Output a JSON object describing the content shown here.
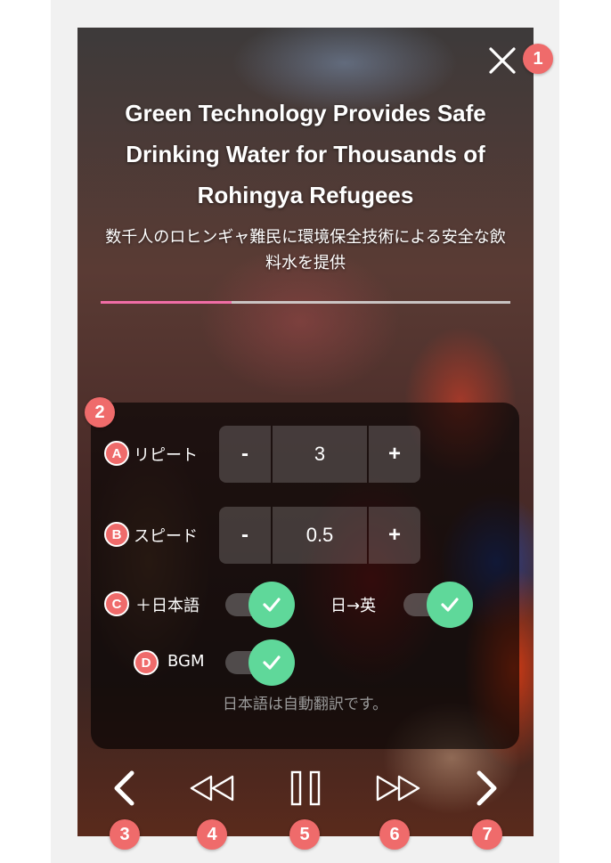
{
  "article": {
    "title_en": "Green Technology Provides Safe Drinking Water for Thousands of Rohingya Refugees",
    "title_ja": "数千人のロヒンギャ難民に環境保全技術による安全な飲料水を提供",
    "progress": 0.32
  },
  "settings": {
    "repeat": {
      "label": "リピート",
      "value": "3",
      "minus": "-",
      "plus": "+"
    },
    "speed": {
      "label": "スピード",
      "value": "0.5",
      "minus": "-",
      "plus": "+"
    },
    "toggles": {
      "japanese": {
        "label": "＋日本語",
        "on": true
      },
      "ja_to_en": {
        "label": "日→英",
        "on": true
      },
      "bgm": {
        "label": "BGM",
        "on": true
      }
    },
    "note": "日本語は自動翻訳です。"
  },
  "badges": {
    "close": "1",
    "panel": "2",
    "prev": "3",
    "rewind": "4",
    "pause": "5",
    "forward": "6",
    "next": "7",
    "repeat": "A",
    "speed": "B",
    "japanese": "C",
    "bgm": "D"
  },
  "icons": {
    "close": "close-icon",
    "check": "check-icon",
    "prev": "chevron-left-icon",
    "rewind": "rewind-icon",
    "pause": "pause-icon",
    "forward": "fast-forward-icon",
    "next": "chevron-right-icon"
  },
  "colors": {
    "badge": "#ef6b6b",
    "toggle_on": "#5fd89a",
    "progress": "#f06da6",
    "panel_bg": "#f1f1f1"
  }
}
